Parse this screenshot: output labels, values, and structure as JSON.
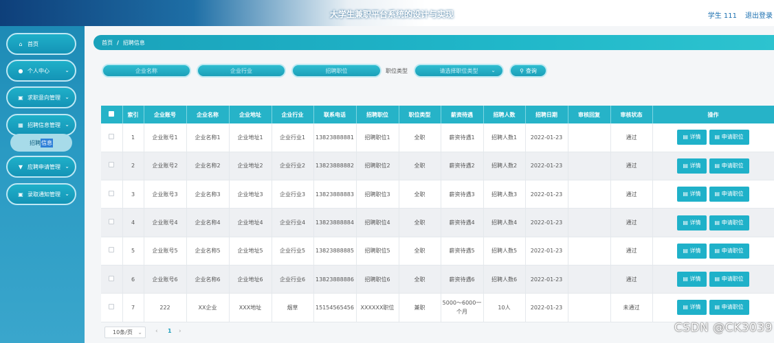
{
  "header": {
    "title": "大学生兼职平台系统的设计与实现",
    "user": "学生 111",
    "logout": "退出登录"
  },
  "sidebar": {
    "items": [
      {
        "label": "首页",
        "icon": "home-icon",
        "glyph": "⌂"
      },
      {
        "label": "个人中心",
        "icon": "user-icon",
        "glyph": "●"
      },
      {
        "label": "求职意向管理",
        "icon": "clipboard-icon",
        "glyph": "▣"
      },
      {
        "label": "招聘信息管理",
        "icon": "grid-icon",
        "glyph": "▦"
      },
      {
        "label": "应聘申请管理",
        "icon": "funnel-icon",
        "glyph": "▼"
      },
      {
        "label": "录取通知管理",
        "icon": "clipboard-icon",
        "glyph": "▣"
      }
    ],
    "submenu": {
      "part1": "招聘",
      "part2": "信息"
    }
  },
  "breadcrumb": {
    "home": "首页",
    "separator": "/",
    "current": "招聘信息"
  },
  "search": {
    "company_name_placeholder": "企业名称",
    "industry_placeholder": "企业行业",
    "position_placeholder": "招聘职位",
    "type_label": "职位类型",
    "type_select_placeholder": "请选择职位类型",
    "query_button": "查询"
  },
  "table": {
    "headers": [
      "索引",
      "企业账号",
      "企业名称",
      "企业地址",
      "企业行业",
      "联系电话",
      "招聘职位",
      "职位类型",
      "薪资待遇",
      "招聘人数",
      "招聘日期",
      "审核回复",
      "审核状态",
      "操作"
    ],
    "rows": [
      [
        "1",
        "企业账号1",
        "企业名称1",
        "企业地址1",
        "企业行业1",
        "13823888881",
        "招聘职位1",
        "全职",
        "薪资待遇1",
        "招聘人数1",
        "2022-01-23",
        "",
        "通过"
      ],
      [
        "2",
        "企业账号2",
        "企业名称2",
        "企业地址2",
        "企业行业2",
        "13823888882",
        "招聘职位2",
        "全职",
        "薪资待遇2",
        "招聘人数2",
        "2022-01-23",
        "",
        "通过"
      ],
      [
        "3",
        "企业账号3",
        "企业名称3",
        "企业地址3",
        "企业行业3",
        "13823888883",
        "招聘职位3",
        "全职",
        "薪资待遇3",
        "招聘人数3",
        "2022-01-23",
        "",
        "通过"
      ],
      [
        "4",
        "企业账号4",
        "企业名称4",
        "企业地址4",
        "企业行业4",
        "13823888884",
        "招聘职位4",
        "全职",
        "薪资待遇4",
        "招聘人数4",
        "2022-01-23",
        "",
        "通过"
      ],
      [
        "5",
        "企业账号5",
        "企业名称5",
        "企业地址5",
        "企业行业5",
        "13823888885",
        "招聘职位5",
        "全职",
        "薪资待遇5",
        "招聘人数5",
        "2022-01-23",
        "",
        "通过"
      ],
      [
        "6",
        "企业账号6",
        "企业名称6",
        "企业地址6",
        "企业行业6",
        "13823888886",
        "招聘职位6",
        "全职",
        "薪资待遇6",
        "招聘人数6",
        "2022-01-23",
        "",
        "通过"
      ],
      [
        "7",
        "222",
        "XX企业",
        "XXX地址",
        "烟草",
        "15154565456",
        "XXXXXX职位",
        "兼职",
        "5000～6000一个月",
        "10人",
        "2022-01-23",
        "",
        "未通过"
      ]
    ],
    "detail_button": "详情",
    "apply_button": "申请职位"
  },
  "pagination": {
    "page_size": "10条/页",
    "prev": "‹",
    "current_page": "1",
    "next": "›"
  },
  "watermark": "CSDN @CK3039"
}
